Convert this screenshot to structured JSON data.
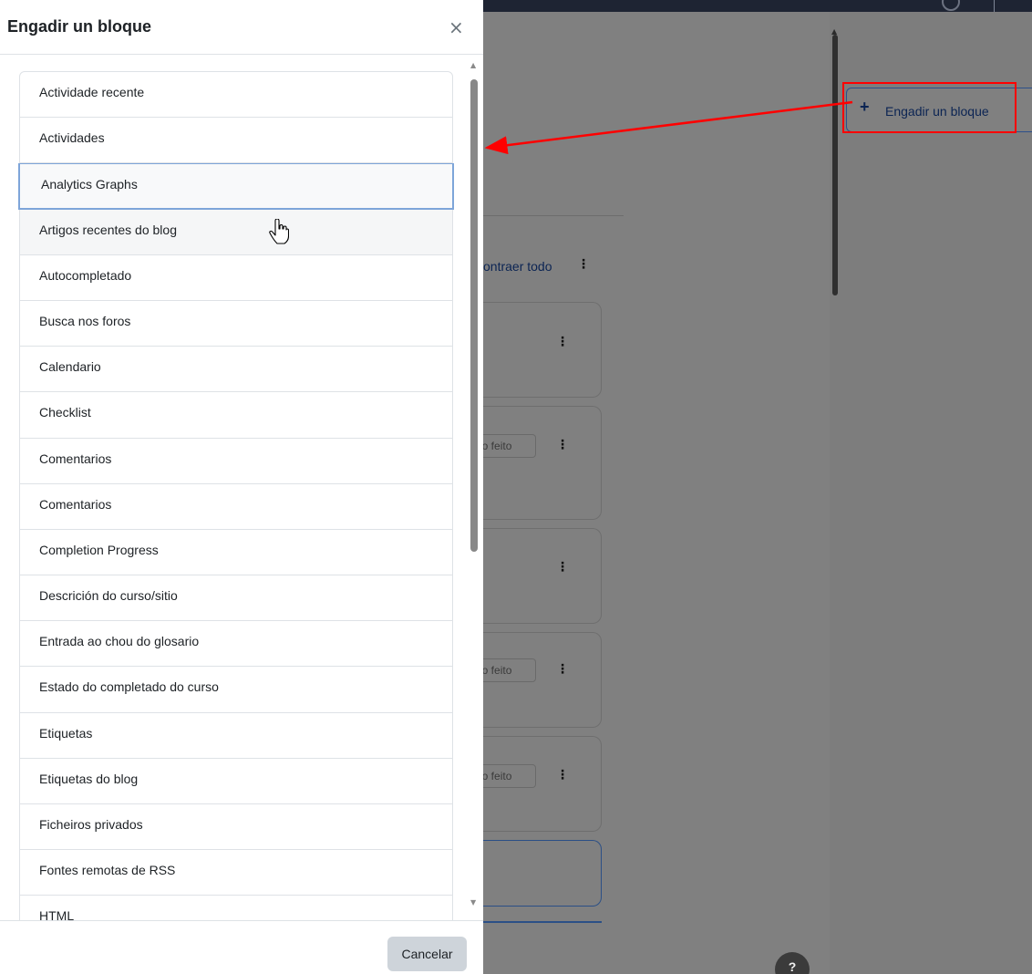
{
  "modal": {
    "title": "Engadir un bloque",
    "close_glyph": "×",
    "cancel_label": "Cancelar",
    "blocks": [
      "Actividade recente",
      "Actividades",
      "Analytics Graphs",
      "Artigos recentes do blog",
      "Autocompletado",
      "Busca nos foros",
      "Calendario",
      "Checklist",
      "Comentarios",
      "Comentarios",
      "Completion Progress",
      "Descrición do curso/sitio",
      "Entrada ao chou do glosario",
      "Estado do completado do curso",
      "Etiquetas",
      "Etiquetas do blog",
      "Ficheiros privados",
      "Fontes remotas de RSS",
      "HTML"
    ],
    "focused_index": 2,
    "hovered_index": 3
  },
  "background": {
    "collapse_link": "ontraer todo",
    "done_label": "no feito",
    "add_block_label": "Engadir un bloque",
    "add_block_plus": "+",
    "help_label": "?"
  },
  "icons": {
    "close": "close-icon",
    "plus": "plus-icon",
    "kebab": "kebab-menu-icon",
    "cursor": "hand-cursor-icon",
    "help": "help-icon"
  },
  "colors": {
    "overlay": "#808080",
    "topbar": "#1e2433",
    "annotation": "#ff0000",
    "link": "#0b2453",
    "focus_border": "#7ea5d9",
    "cancel_bg": "#ced4da"
  }
}
